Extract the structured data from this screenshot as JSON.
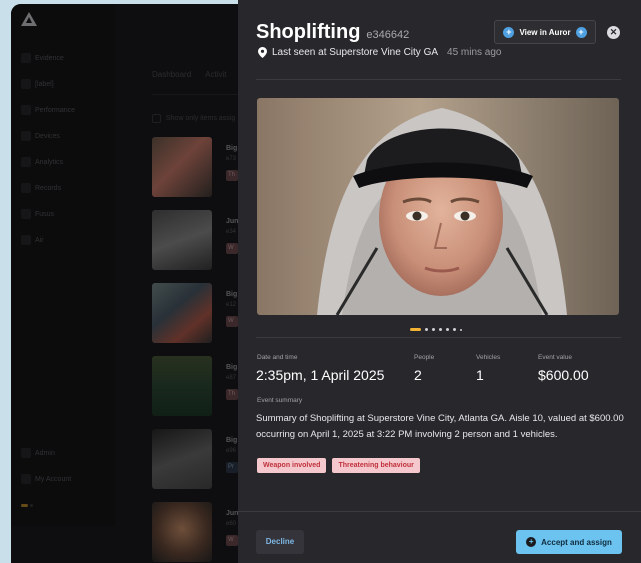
{
  "sidebar": {
    "items": [
      {
        "label": "Evidence"
      },
      {
        "label": "[label]"
      },
      {
        "label": "Performance"
      },
      {
        "label": "Devices"
      },
      {
        "label": "Analytics"
      },
      {
        "label": "Records"
      },
      {
        "label": "Fusus"
      },
      {
        "label": "Air"
      }
    ],
    "bottom_items": [
      {
        "label": "Admin"
      },
      {
        "label": "My Account"
      }
    ]
  },
  "background": {
    "tabs": [
      "Dashboard",
      "Activit"
    ],
    "filter_label": "Show only items assig",
    "list": [
      {
        "title": "Big",
        "id": "e73",
        "badge": "Th"
      },
      {
        "title": "Jun",
        "id": "e34",
        "badge": "W"
      },
      {
        "title": "Big",
        "id": "e12",
        "badge": "W"
      },
      {
        "title": "Big",
        "id": "e87",
        "badge": "Th"
      },
      {
        "title": "Big",
        "id": "e96",
        "badge": "Pr"
      },
      {
        "title": "Jun",
        "id": "e60",
        "badge": "W"
      }
    ]
  },
  "panel": {
    "title": "Shoplifting",
    "event_id": "e346642",
    "view_button": "View in Auror",
    "location": "Last seen at Superstore Vine City GA",
    "time_ago": "45 mins ago",
    "carousel": {
      "active": 0,
      "count": 7
    },
    "fields": {
      "date_label": "Date and time",
      "date_value": "2:35pm, 1 April 2025",
      "people_label": "People",
      "people_value": "2",
      "vehicles_label": "Vehicles",
      "vehicles_value": "1",
      "value_label": "Event value",
      "value_value": "$600.00"
    },
    "summary_label": "Event summary",
    "summary_text": "Summary of Shoplifting at Superstore Vine City, Atlanta GA. Aisle 10, valued at $600.00 occurring on April 1, 2025 at 3:22 PM involving 2 person and 1 vehicles.",
    "tags": [
      "Weapon involved",
      "Threatening behaviour"
    ],
    "decline_label": "Decline",
    "accept_label": "Accept and assign"
  },
  "colors": {
    "accent_blue": "#6cc3f0",
    "tag_red": "#c0313c",
    "carousel_active": "#f2b233"
  }
}
